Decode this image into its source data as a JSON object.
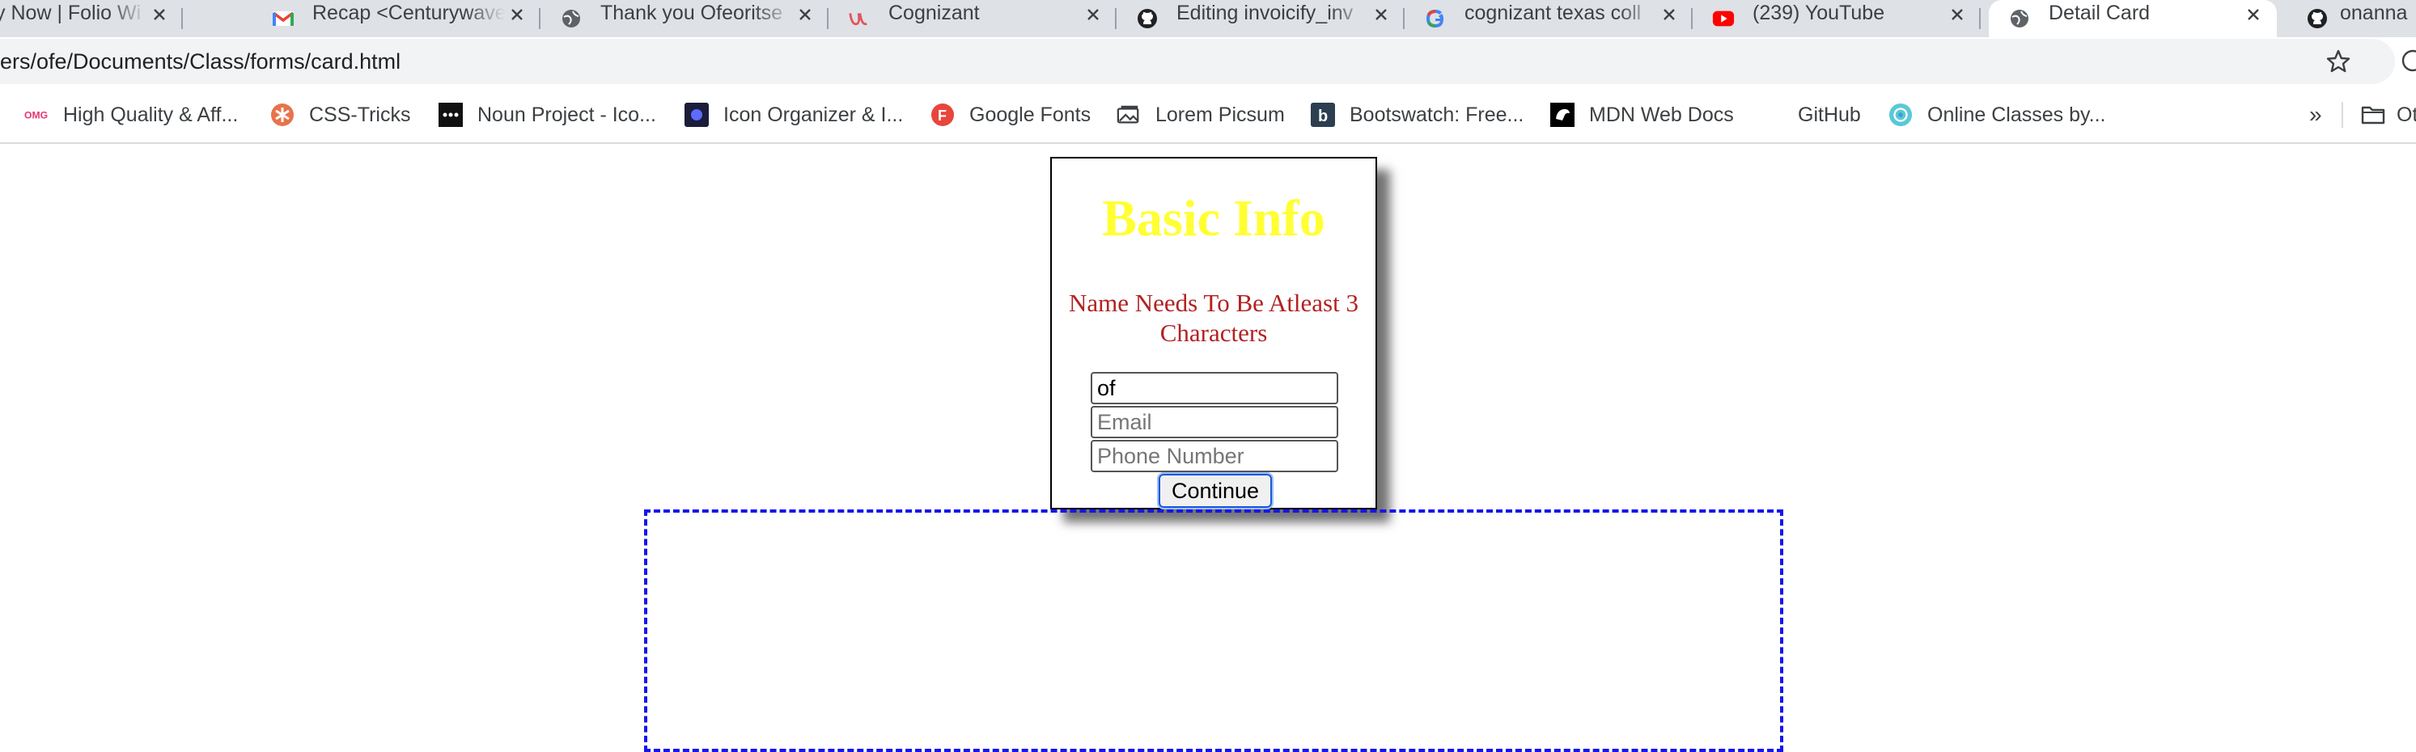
{
  "browser": {
    "tabs": [
      {
        "title": "Apply Now | Folio Wi",
        "icon": "globe-icon",
        "active": false
      },
      {
        "title": "Recap <Centurywave",
        "icon": "gmail-icon",
        "active": false
      },
      {
        "title": "Thank you Ofeoritse",
        "icon": "globe-icon",
        "active": false
      },
      {
        "title": "Cognizant",
        "icon": "cognizant-icon",
        "active": false
      },
      {
        "title": "Editing invoicify_inv",
        "icon": "github-icon",
        "active": false
      },
      {
        "title": "cognizant texas coll",
        "icon": "google-icon",
        "active": false
      },
      {
        "title": "(239) YouTube",
        "icon": "youtube-icon",
        "active": false
      },
      {
        "title": "Detail Card",
        "icon": "globe-icon",
        "active": true
      },
      {
        "title": "onanna",
        "icon": "github-icon",
        "active": false
      }
    ],
    "url": "ers/ofe/Documents/Class/forms/card.html",
    "bookmarks": [
      {
        "label": "High Quality & Aff...",
        "icon": "omg-icon"
      },
      {
        "label": "CSS-Tricks",
        "icon": "css-tricks-icon"
      },
      {
        "label": "Noun Project - Ico...",
        "icon": "noun-project-icon"
      },
      {
        "label": "Icon Organizer & I...",
        "icon": "icon-organizer-icon"
      },
      {
        "label": "Google Fonts",
        "icon": "google-fonts-icon"
      },
      {
        "label": "Lorem Picsum",
        "icon": "picsum-icon"
      },
      {
        "label": "Bootswatch: Free...",
        "icon": "bootswatch-icon"
      },
      {
        "label": "MDN Web Docs",
        "icon": "mdn-icon"
      },
      {
        "label": "GitHub",
        "icon": ""
      },
      {
        "label": "Online Classes by...",
        "icon": "online-classes-icon"
      }
    ],
    "bookmarks_overflow": "»",
    "other_bookmarks_label": "Ot"
  },
  "page": {
    "title": "Basic Info",
    "error": "Name Needs To Be Atleast 3 Characters",
    "form": {
      "name_value": "of",
      "email_placeholder": "Email",
      "phone_placeholder": "Phone Number",
      "continue_label": "Continue"
    }
  },
  "colors": {
    "title": "#ffff33",
    "error": "#b22222",
    "dashed_border": "#1515ee"
  }
}
